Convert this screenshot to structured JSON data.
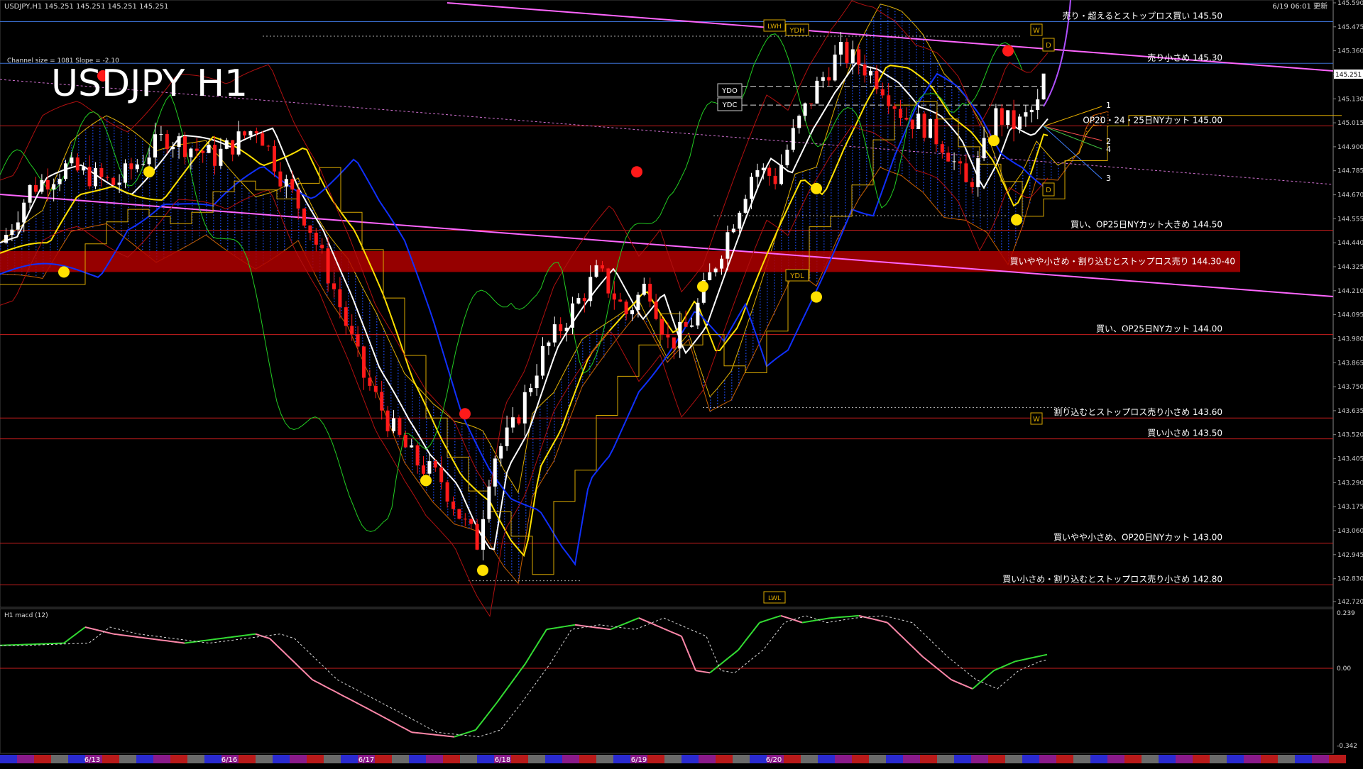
{
  "header": {
    "symbol_line": "USDJPY,H1  145.251 145.251 145.251 145.251",
    "timestamp": "6/19 06:01 更新",
    "channel_info": "Channel size = 1081 Slope = -2.10",
    "big_title": "USDJPY H1"
  },
  "current_price": "145.251",
  "colors": {
    "background": "#000000",
    "bull_candle": "#ffffff",
    "bear_candle": "#ff1a1a",
    "level_line": "#c81e1e",
    "highlight_zone": "#b00000",
    "ma_white": "#ffffff",
    "ma_yellow": "#ffe000",
    "ma_blue": "#1030ff",
    "trend_magenta": "#ff66ff",
    "chikou_green": "#22cc22",
    "cloud_gold": "#e0b000",
    "macd_up": "#33dd33",
    "macd_down": "#ff88aa",
    "signal": "#dddddd"
  },
  "price_axis": {
    "min": 142.72,
    "max": 145.59,
    "ticks": [
      "145.590",
      "145.475",
      "145.360",
      "145.245",
      "145.130",
      "145.015",
      "144.900",
      "144.785",
      "144.670",
      "144.555",
      "144.440",
      "144.325",
      "144.210",
      "144.095",
      "143.980",
      "143.865",
      "143.750",
      "143.635",
      "143.520",
      "143.405",
      "143.290",
      "143.175",
      "143.060",
      "142.945",
      "142.830",
      "142.720"
    ]
  },
  "macd": {
    "title": "H1  macd (12)",
    "top_label": "0.239",
    "zero_label": "0.00",
    "bottom_label": "-0.342"
  },
  "dates": [
    "6/13",
    "6/16",
    "6/17",
    "6/18",
    "6/19",
    "6/20"
  ],
  "annotations": {
    "lines": [
      {
        "price": 145.5,
        "text": "売り・超えるとストップロス買い 145.50"
      },
      {
        "price": 145.3,
        "text": "売り小さめ 145.30"
      },
      {
        "price": 145.0,
        "text": "OP20・24・25日NYカット 145.00"
      },
      {
        "price": 144.5,
        "text": "買い、OP25日NYカット大きめ 144.50"
      },
      {
        "price": 144.35,
        "text": "買いやや小さめ・割り込むとストップロス売り 144.30-40"
      },
      {
        "price": 144.0,
        "text": "買い、OP25日NYカット 144.00"
      },
      {
        "price": 143.6,
        "text": "割り込むとストップロス売り小さめ 143.60"
      },
      {
        "price": 143.5,
        "text": "買い小さめ 143.50"
      },
      {
        "price": 143.0,
        "text": "買いやや小さめ、OP20日NYカット 143.00"
      },
      {
        "price": 142.8,
        "text": "買い小さめ・割り込むとストップロス売り小さめ 142.80"
      }
    ],
    "tags": {
      "ydo": "YDO",
      "ydc": "YDC",
      "ydh": "YDH",
      "ydl": "YDL",
      "lwl": "LWL",
      "lwh": "LWH",
      "w1": "W",
      "w2": "W",
      "d1": "D",
      "d2": "D",
      "fan1": "1",
      "fan2": "2",
      "fan3": "3",
      "fan4": "4"
    }
  },
  "chart_data": {
    "type": "candlestick",
    "title": "USDJPY H1",
    "ylim": [
      142.72,
      145.59
    ],
    "x_categories": [
      "6/13",
      "6/16",
      "6/17",
      "6/18",
      "6/19",
      "6/20"
    ],
    "levels": [
      145.5,
      145.3,
      145.0,
      144.5,
      144.35,
      144.0,
      143.6,
      143.5,
      143.0,
      142.8
    ],
    "last_close": 145.251
  }
}
